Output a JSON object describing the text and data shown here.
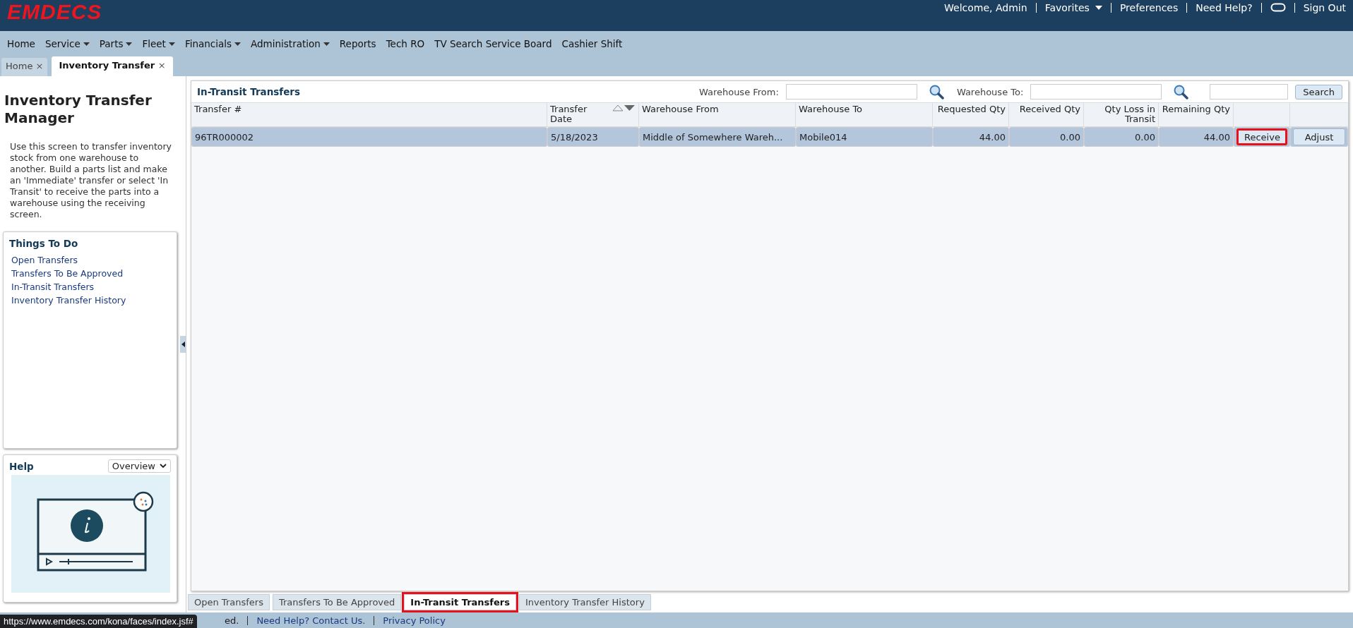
{
  "header": {
    "logo": "EMDECS",
    "links": [
      {
        "label": "Welcome, Admin",
        "kind": "text"
      },
      {
        "label": "Favorites",
        "kind": "menu"
      },
      {
        "label": "Preferences",
        "kind": "link"
      },
      {
        "label": "Need Help?",
        "kind": "link"
      },
      {
        "kind": "chat"
      },
      {
        "label": "Sign Out",
        "kind": "link"
      }
    ]
  },
  "nav": [
    {
      "label": "Home",
      "dropdown": false
    },
    {
      "label": "Service",
      "dropdown": true
    },
    {
      "label": "Parts",
      "dropdown": true
    },
    {
      "label": "Fleet",
      "dropdown": true
    },
    {
      "label": "Financials",
      "dropdown": true
    },
    {
      "label": "Administration",
      "dropdown": true
    },
    {
      "label": "Reports",
      "dropdown": false
    },
    {
      "label": "Tech RO",
      "dropdown": false
    },
    {
      "label": "TV Search Service Board",
      "dropdown": false
    },
    {
      "label": "Cashier Shift",
      "dropdown": false
    }
  ],
  "page_tabs": [
    {
      "label": "Home",
      "close": "×",
      "selected": false
    },
    {
      "label": "Inventory Transfer",
      "close": "×",
      "selected": true
    }
  ],
  "sidebar": {
    "title": "Inventory Transfer Manager",
    "description": "Use this screen to transfer inventory stock from one warehouse to another. Build a parts list and make an 'Immediate' transfer or select 'In Transit' to receive the parts into a warehouse using the receiving screen.",
    "things_to_do": {
      "title": "Things To Do",
      "items": [
        "Open Transfers",
        "Transfers To Be Approved",
        "In-Transit Transfers",
        "Inventory Transfer History"
      ]
    },
    "help": {
      "title": "Help",
      "select": "Overview"
    }
  },
  "grid": {
    "title": "In-Transit Transfers",
    "filters": [
      {
        "label": "Warehouse From:"
      },
      {
        "label": "Warehouse To:"
      }
    ],
    "search_button": "Search",
    "columns": [
      "Transfer #",
      "Transfer Date",
      "Warehouse From",
      "Warehouse To",
      "Requested Qty",
      "Received Qty",
      "Qty Loss in Transit",
      "Remaining Qty"
    ],
    "rows": [
      {
        "selected": true,
        "cells": [
          "96TR000002",
          "5/18/2023",
          "Middle of Somewhere Wareh...",
          "Mobile014",
          "44.00",
          "0.00",
          "0.00",
          "44.00"
        ],
        "actions": [
          {
            "label": "Receive",
            "highlighted": true
          },
          {
            "label": "Adjust",
            "highlighted": false
          }
        ]
      }
    ]
  },
  "bottom_tabs": [
    {
      "label": "Open Transfers",
      "selected": false,
      "highlighted": false
    },
    {
      "label": "Transfers To Be Approved",
      "selected": false,
      "highlighted": false
    },
    {
      "label": "In-Transit Transfers",
      "selected": true,
      "highlighted": true
    },
    {
      "label": "Inventory Transfer History",
      "selected": false,
      "highlighted": false
    }
  ],
  "footer": [
    "ed.",
    "Need Help? Contact Us.",
    "Privacy Policy"
  ],
  "status_url": "https://www.emdecs.com/kona/faces/index.jsf#"
}
